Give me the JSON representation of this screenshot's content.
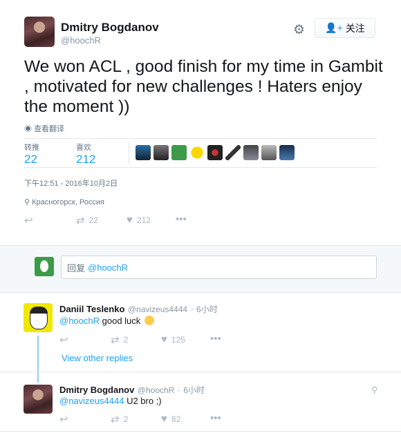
{
  "tweet": {
    "author_name": "Dmitry Bogdanov",
    "author_handle": "@hoochR",
    "follow_label": "关注",
    "text": "We won ACL , good  finish for my time in Gambit , motivated for new challenges ! Haters enjoy the moment ))",
    "translate_label": "查看翻译",
    "retweets_label": "转推",
    "retweets": "22",
    "likes_label": "喜欢",
    "likes": "212",
    "date": "下午12:51 - 2016年10月2日",
    "location": "Красногорск, Россия",
    "actions": {
      "retweet_count": "22",
      "like_count": "212"
    }
  },
  "reply_box": {
    "prefix": "回复",
    "handle": "@hoochR"
  },
  "replies": [
    {
      "name": "Daniil Teslenko",
      "handle": "@navizeus4444",
      "time": "6小时",
      "mention": "@hoochR",
      "text": "good luck",
      "retweet_count": "2",
      "like_count": "125",
      "other_replies": "View other replies"
    },
    {
      "name": "Dmitry Bogdanov",
      "handle": "@hoochR",
      "time": "6小时",
      "mention": "@navizeus4444",
      "text": "U2 bro ;)",
      "retweet_count": "2",
      "like_count": "82"
    }
  ],
  "icons": {
    "gear": "gear-icon",
    "follow": "add-user-icon",
    "globe": "globe-icon",
    "pin": "location-pin-icon",
    "reply": "reply-icon",
    "retweet": "retweet-icon",
    "like": "heart-icon",
    "more": "more-icon"
  },
  "colors": {
    "accent": "#1da1f2",
    "muted": "#657786",
    "border": "#e1e8ed"
  }
}
